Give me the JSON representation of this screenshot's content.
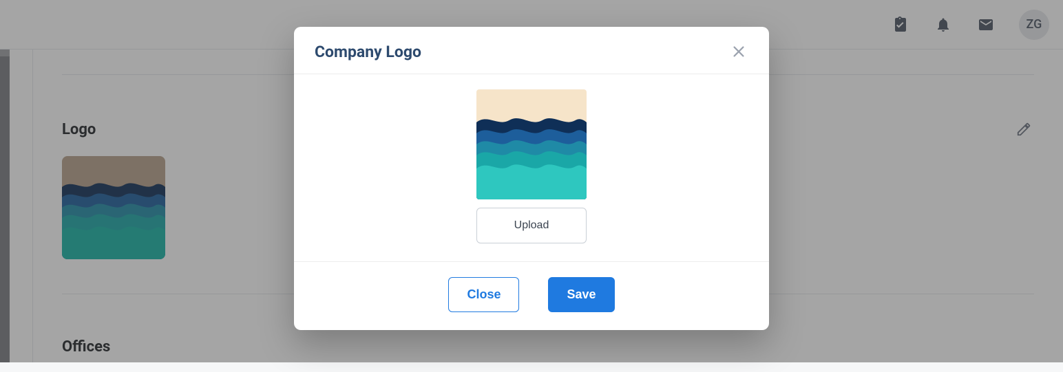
{
  "topbar": {
    "clipboard_icon": "clipboard-check",
    "bell_icon": "bell",
    "mail_icon": "mail",
    "avatar_initials": "ZG"
  },
  "page": {
    "section_logo_title": "Logo",
    "section_offices_title": "Offices"
  },
  "modal": {
    "title": "Company Logo",
    "upload_label": "Upload",
    "close_label": "Close",
    "save_label": "Save"
  }
}
